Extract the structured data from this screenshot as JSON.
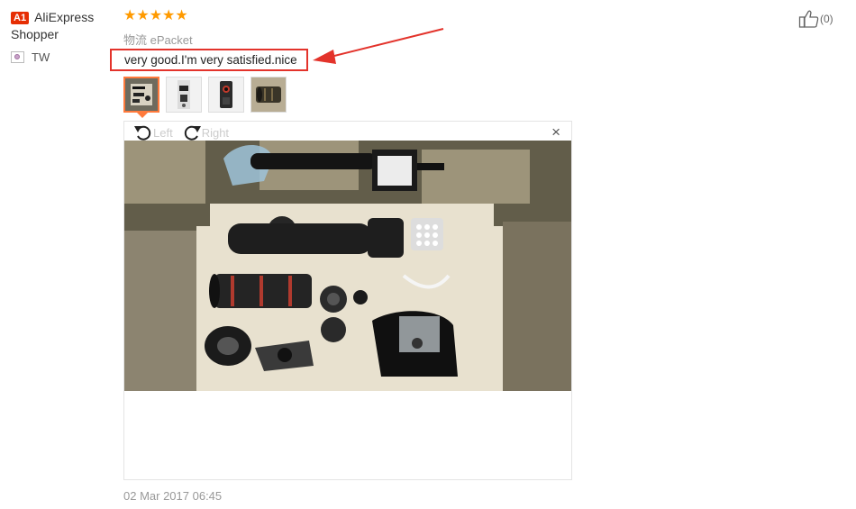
{
  "reviewer": {
    "badge": "A1",
    "name": "AliExpress Shopper",
    "country": "TW"
  },
  "review": {
    "rating": 5,
    "stars": "★★★★★",
    "logistics": "物流 ePacket",
    "text": "very good.I'm very satisfied.nice",
    "date": "02 Mar 2017 06:45"
  },
  "viewer": {
    "rotate_left_label": "Left",
    "rotate_right_label": "Right",
    "close_label": "×"
  },
  "helpful": {
    "count_label": "(0)"
  },
  "colors": {
    "star": "#ff9a00",
    "badge": "#e62e04",
    "highlight_box": "#e3332b",
    "active_thumb": "#ff7a3c"
  },
  "icons": [
    "flag-icon",
    "rotate-left-icon",
    "rotate-right-icon",
    "close-icon",
    "thumbs-up-icon",
    "annotation-arrow"
  ]
}
